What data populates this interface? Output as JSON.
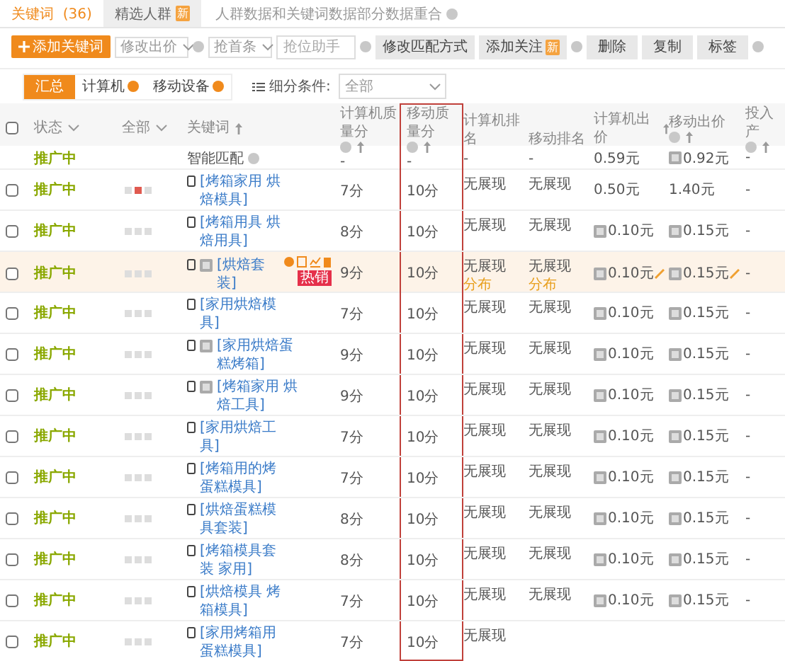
{
  "tabs": [
    {
      "label": "关键词",
      "count": "(36)",
      "selected": true
    },
    {
      "label": "精选人群",
      "selected": false,
      "badge": "新"
    }
  ],
  "select_all_checked": false,
  "tabs_note": "人群数据和关键词数据部分数据重合",
  "toolbar": {
    "add_button": "添加关键词",
    "bid_select": "修改出价",
    "top_select": "抢首条",
    "assistant_placeholder": "抢位助手",
    "match_button": "修改匹配方式",
    "follow_button": "添加关注",
    "follow_badge": "新",
    "delete_button": "删除",
    "copy_button": "复制",
    "tag_button": "标签"
  },
  "filters": {
    "segments": [
      {
        "label": "汇总",
        "selected": true,
        "help": false
      },
      {
        "label": "计算机",
        "selected": false,
        "help": true
      },
      {
        "label": "移动设备",
        "selected": false,
        "help": true
      }
    ],
    "condition_label": "细分条件:",
    "condition_value": "全部"
  },
  "columns": [
    {
      "label": "状态",
      "kind": "dropdown",
      "outlined": false
    },
    {
      "label": "全部",
      "kind": "dropdown",
      "outlined": false
    },
    {
      "label": "关键词",
      "kind": "sort",
      "outlined": false
    },
    {
      "label": "计算机质量分",
      "kind": "help_sort",
      "outlined": false
    },
    {
      "label": "移动质量分",
      "kind": "help_sort",
      "outlined": true
    },
    {
      "label": "计算机排名",
      "kind": "plain",
      "outlined": false
    },
    {
      "label": "移动排名",
      "kind": "plain",
      "outlined": false
    },
    {
      "label": "计算机出价",
      "kind": "sort",
      "outlined": false
    },
    {
      "label": "移动出价",
      "kind": "help_sort",
      "outlined": false
    },
    {
      "label": "投入产",
      "kind": "help_sort",
      "outlined": false
    }
  ],
  "rows": [
    {
      "kind": "smart",
      "status": "推广中",
      "keyword": "智能匹配",
      "pc_quality": "-",
      "m_quality": "-",
      "pc_rank": "-",
      "m_rank": "-",
      "pc_price": "0.59元",
      "pc_price_icon": false,
      "m_price": "0.92元",
      "m_price_icon": true,
      "roi": "-",
      "hovered": false
    },
    {
      "kind": "keyword",
      "checked": false,
      "status": "推广中",
      "marks": [
        {
          "on": false
        },
        {
          "on": true
        },
        {
          "on": false
        }
      ],
      "keyword": "[烤箱家用 烘焙模具]",
      "tag_icon": false,
      "hovered": false,
      "pc_quality": "7分",
      "m_quality": "10分",
      "pc_rank": "无展现",
      "m_rank": "无展现",
      "pc_price": "0.50元",
      "pc_price_icon": false,
      "m_price": "1.40元",
      "m_price_icon": false,
      "roi": "-"
    },
    {
      "kind": "keyword",
      "checked": false,
      "status": "推广中",
      "marks": [
        {
          "on": false
        },
        {
          "on": false
        },
        {
          "on": false
        }
      ],
      "keyword": "[烤箱用具 烘焙用具]",
      "tag_icon": false,
      "hovered": false,
      "pc_quality": "8分",
      "m_quality": "10分",
      "pc_rank": "无展现",
      "m_rank": "无展现",
      "pc_price": "0.10元",
      "pc_price_icon": true,
      "m_price": "0.15元",
      "m_price_icon": true,
      "roi": "-"
    },
    {
      "kind": "keyword",
      "checked": false,
      "status": "推广中",
      "marks": [
        {
          "on": false
        },
        {
          "on": false
        },
        {
          "on": false
        }
      ],
      "keyword": "[烘焙套装]",
      "tag_icon": true,
      "hovered": true,
      "badge": "热销",
      "pc_quality": "9分",
      "m_quality": "10分",
      "pc_rank": "无展现",
      "pc_rank_link": "分布",
      "m_rank": "无展现",
      "m_rank_link": "分布",
      "pc_price": "0.10元",
      "pc_price_icon": true,
      "m_price": "0.15元",
      "m_price_icon": true,
      "roi": "-"
    },
    {
      "kind": "keyword",
      "checked": false,
      "status": "推广中",
      "marks": [
        {
          "on": false
        },
        {
          "on": false
        },
        {
          "on": false
        }
      ],
      "keyword": "[家用烘焙模具]",
      "tag_icon": false,
      "hovered": false,
      "pc_quality": "7分",
      "m_quality": "10分",
      "pc_rank": "无展现",
      "m_rank": "无展现",
      "pc_price": "0.10元",
      "pc_price_icon": true,
      "m_price": "0.15元",
      "m_price_icon": true,
      "roi": "-"
    },
    {
      "kind": "keyword",
      "checked": false,
      "status": "推广中",
      "marks": [
        {
          "on": false
        },
        {
          "on": false
        },
        {
          "on": false
        }
      ],
      "keyword": "[家用烘焙蛋糕烤箱]",
      "tag_icon": true,
      "hovered": false,
      "pc_quality": "9分",
      "m_quality": "10分",
      "pc_rank": "无展现",
      "m_rank": "无展现",
      "pc_price": "0.10元",
      "pc_price_icon": true,
      "m_price": "0.15元",
      "m_price_icon": true,
      "roi": "-"
    },
    {
      "kind": "keyword",
      "checked": false,
      "status": "推广中",
      "marks": [
        {
          "on": false
        },
        {
          "on": false
        },
        {
          "on": false
        }
      ],
      "keyword": "[烤箱家用 烘焙工具]",
      "tag_icon": true,
      "hovered": false,
      "pc_quality": "9分",
      "m_quality": "10分",
      "pc_rank": "无展现",
      "m_rank": "无展现",
      "pc_price": "0.10元",
      "pc_price_icon": true,
      "m_price": "0.15元",
      "m_price_icon": true,
      "roi": "-"
    },
    {
      "kind": "keyword",
      "checked": false,
      "status": "推广中",
      "marks": [
        {
          "on": false
        },
        {
          "on": false
        },
        {
          "on": false
        }
      ],
      "keyword": "[家用烘焙工具]",
      "tag_icon": false,
      "hovered": false,
      "pc_quality": "7分",
      "m_quality": "10分",
      "pc_rank": "无展现",
      "m_rank": "无展现",
      "pc_price": "0.10元",
      "pc_price_icon": true,
      "m_price": "0.15元",
      "m_price_icon": true,
      "roi": "-"
    },
    {
      "kind": "keyword",
      "checked": false,
      "status": "推广中",
      "marks": [
        {
          "on": false
        },
        {
          "on": false
        },
        {
          "on": false
        }
      ],
      "keyword": "[烤箱用的烤蛋糕模具]",
      "tag_icon": false,
      "hovered": false,
      "pc_quality": "7分",
      "m_quality": "10分",
      "pc_rank": "无展现",
      "m_rank": "无展现",
      "pc_price": "0.10元",
      "pc_price_icon": true,
      "m_price": "0.15元",
      "m_price_icon": true,
      "roi": "-"
    },
    {
      "kind": "keyword",
      "checked": false,
      "status": "推广中",
      "marks": [
        {
          "on": false
        },
        {
          "on": false
        },
        {
          "on": false
        }
      ],
      "keyword": "[烘焙蛋糕模具套装]",
      "tag_icon": false,
      "hovered": false,
      "pc_quality": "8分",
      "m_quality": "10分",
      "pc_rank": "无展现",
      "m_rank": "无展现",
      "pc_price": "0.10元",
      "pc_price_icon": true,
      "m_price": "0.15元",
      "m_price_icon": true,
      "roi": "-"
    },
    {
      "kind": "keyword",
      "checked": false,
      "status": "推广中",
      "marks": [
        {
          "on": false
        },
        {
          "on": false
        },
        {
          "on": false
        }
      ],
      "keyword": "[烤箱模具套装 家用]",
      "tag_icon": false,
      "hovered": false,
      "pc_quality": "8分",
      "m_quality": "10分",
      "pc_rank": "无展现",
      "m_rank": "无展现",
      "pc_price": "0.10元",
      "pc_price_icon": true,
      "m_price": "0.15元",
      "m_price_icon": true,
      "roi": "-"
    },
    {
      "kind": "keyword",
      "checked": false,
      "status": "推广中",
      "marks": [
        {
          "on": false
        },
        {
          "on": false
        },
        {
          "on": false
        }
      ],
      "keyword": "[烘焙模具 烤箱模具]",
      "tag_icon": false,
      "hovered": false,
      "pc_quality": "7分",
      "m_quality": "10分",
      "pc_rank": "无展现",
      "m_rank": "无展现",
      "pc_price": "0.10元",
      "pc_price_icon": true,
      "m_price": "0.15元",
      "m_price_icon": true,
      "roi": "-"
    },
    {
      "kind": "keyword",
      "checked": false,
      "status": "推广中",
      "marks": [
        {
          "on": false
        },
        {
          "on": false
        },
        {
          "on": false
        }
      ],
      "keyword": "[家用烤箱用蛋糕模具]",
      "tag_icon": false,
      "hovered": false,
      "pc_quality": "7分",
      "m_quality": "10分",
      "pc_rank": "无展现"
    }
  ]
}
